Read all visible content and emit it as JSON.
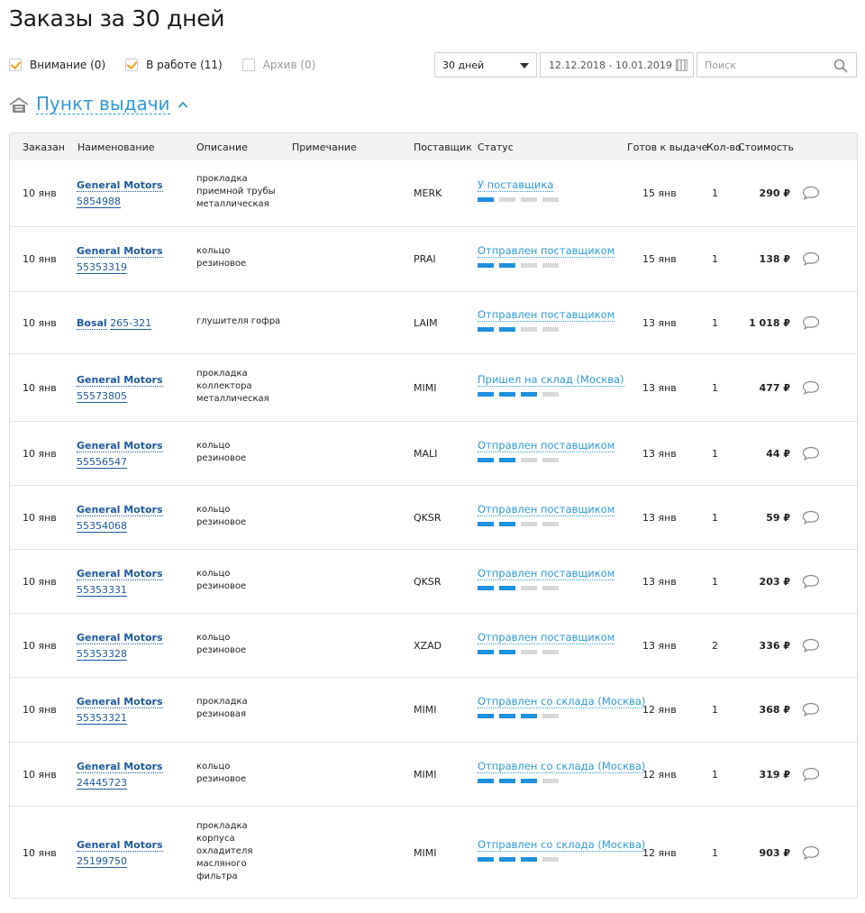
{
  "page": {
    "title": "Заказы за 30 дней"
  },
  "filters": {
    "attention": {
      "label": "Внимание (0)",
      "checked": true
    },
    "in_work": {
      "label": "В работе (11)",
      "checked": true
    },
    "archive": {
      "label": "Архив (0)",
      "checked": false
    },
    "period": "30 дней",
    "date_range": "12.12.2018 - 10.01.2019",
    "search_placeholder": "Поиск"
  },
  "pickup": {
    "title": "Пункт выдачи"
  },
  "colors": {
    "accent": "#2e9ad8",
    "link": "#1e5aa0",
    "check": "#f0a020",
    "progress_on": "#1e90e0",
    "progress_off": "#d8d8d8"
  },
  "table": {
    "headers": {
      "ordered": "Заказан",
      "name": "Наименование",
      "description": "Описание",
      "note": "Примечание",
      "supplier": "Поставщик",
      "status": "Статус",
      "ready": "Готов к выдаче",
      "qty": "Кол-во",
      "cost": "Стоимость"
    },
    "rows": [
      {
        "date": "10 янв",
        "mfr": "General Motors",
        "code": "5854988",
        "desc": [
          "прокладка",
          "приемной трубы",
          "металлическая"
        ],
        "supplier": "MERK",
        "status": "У поставщика",
        "progress": 1,
        "ready": "15 янв",
        "qty": "1",
        "cost": "290 ₽"
      },
      {
        "date": "10 янв",
        "mfr": "General Motors",
        "code": "55353319",
        "desc": [
          "кольцо",
          "резиновое"
        ],
        "supplier": "PRAI",
        "status": "Отправлен поставщиком",
        "progress": 2,
        "ready": "15 янв",
        "qty": "1",
        "cost": "138 ₽"
      },
      {
        "date": "10 янв",
        "mfr": "Bosal",
        "code": "265-321",
        "desc": [
          "глушителя гофра"
        ],
        "supplier": "LAIM",
        "status": "Отправлен поставщиком",
        "progress": 2,
        "ready": "13 янв",
        "qty": "1",
        "cost": "1 018 ₽"
      },
      {
        "date": "10 янв",
        "mfr": "General Motors",
        "code": "55573805",
        "desc": [
          "прокладка",
          "коллектора",
          "металлическая"
        ],
        "supplier": "MIMI",
        "status": "Пришел на склад (Москва)",
        "progress": 3,
        "ready": "13 янв",
        "qty": "1",
        "cost": "477 ₽"
      },
      {
        "date": "10 янв",
        "mfr": "General Motors",
        "code": "55556547",
        "desc": [
          "кольцо",
          "резиновое"
        ],
        "supplier": "MALI",
        "status": "Отправлен поставщиком",
        "progress": 2,
        "ready": "13 янв",
        "qty": "1",
        "cost": "44 ₽"
      },
      {
        "date": "10 янв",
        "mfr": "General Motors",
        "code": "55354068",
        "desc": [
          "кольцо",
          "резиновое"
        ],
        "supplier": "QKSR",
        "status": "Отправлен поставщиком",
        "progress": 2,
        "ready": "13 янв",
        "qty": "1",
        "cost": "59 ₽"
      },
      {
        "date": "10 янв",
        "mfr": "General Motors",
        "code": "55353331",
        "desc": [
          "кольцо",
          "резиновое"
        ],
        "supplier": "QKSR",
        "status": "Отправлен поставщиком",
        "progress": 2,
        "ready": "13 янв",
        "qty": "1",
        "cost": "203 ₽"
      },
      {
        "date": "10 янв",
        "mfr": "General Motors",
        "code": "55353328",
        "desc": [
          "кольцо",
          "резиновое"
        ],
        "supplier": "XZAD",
        "status": "Отправлен поставщиком",
        "progress": 2,
        "ready": "13 янв",
        "qty": "2",
        "cost": "336 ₽"
      },
      {
        "date": "10 янв",
        "mfr": "General Motors",
        "code": "55353321",
        "desc": [
          "прокладка",
          "резиновая"
        ],
        "supplier": "MIMI",
        "status": "Отправлен со склада (Москва)",
        "progress": 3,
        "ready": "12 янв",
        "qty": "1",
        "cost": "368 ₽"
      },
      {
        "date": "10 янв",
        "mfr": "General Motors",
        "code": "24445723",
        "desc": [
          "кольцо",
          "резиновое"
        ],
        "supplier": "MIMI",
        "status": "Отправлен со склада (Москва)",
        "progress": 3,
        "ready": "12 янв",
        "qty": "1",
        "cost": "319 ₽"
      },
      {
        "date": "10 янв",
        "mfr": "General Motors",
        "code": "25199750",
        "desc": [
          "прокладка",
          "корпуса",
          "охладителя",
          "масляного",
          "фильтра"
        ],
        "supplier": "MIMI",
        "status": "Отправлен со склада (Москва)",
        "progress": 3,
        "ready": "12 янв",
        "qty": "1",
        "cost": "903 ₽"
      }
    ]
  }
}
